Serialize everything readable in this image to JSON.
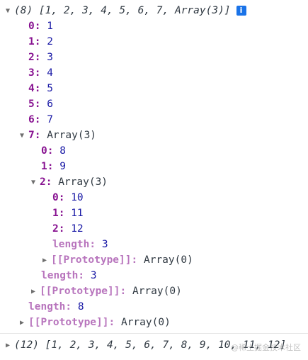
{
  "log1": {
    "summary": "(8) [1, 2, 3, 4, 5, 6, 7, Array(3)]",
    "info_icon": "i",
    "items": [
      {
        "key": "0",
        "value": "1"
      },
      {
        "key": "1",
        "value": "2"
      },
      {
        "key": "2",
        "value": "3"
      },
      {
        "key": "3",
        "value": "4"
      },
      {
        "key": "4",
        "value": "5"
      },
      {
        "key": "5",
        "value": "6"
      },
      {
        "key": "6",
        "value": "7"
      }
    ],
    "nested": {
      "key": "7",
      "label": "Array(3)",
      "items": [
        {
          "key": "0",
          "value": "8"
        },
        {
          "key": "1",
          "value": "9"
        }
      ],
      "nested": {
        "key": "2",
        "label": "Array(3)",
        "items": [
          {
            "key": "0",
            "value": "10"
          },
          {
            "key": "1",
            "value": "11"
          },
          {
            "key": "2",
            "value": "12"
          }
        ],
        "length_key": "length",
        "length_value": "3",
        "proto_key": "[[Prototype]]",
        "proto_value": "Array(0)"
      },
      "length_key": "length",
      "length_value": "3",
      "proto_key": "[[Prototype]]",
      "proto_value": "Array(0)"
    },
    "length_key": "length",
    "length_value": "8",
    "proto_key": "[[Prototype]]",
    "proto_value": "Array(0)"
  },
  "log2": {
    "summary": "(12) [1, 2, 3, 4, 5, 6, 7, 8, 9, 10, 11, 12]"
  },
  "watermark": "@稀土掘金技术社区",
  "colors": {
    "key": "#881391",
    "key_dim": "#b875bd",
    "number": "#1a1aa6",
    "info": "#1a73e8"
  }
}
